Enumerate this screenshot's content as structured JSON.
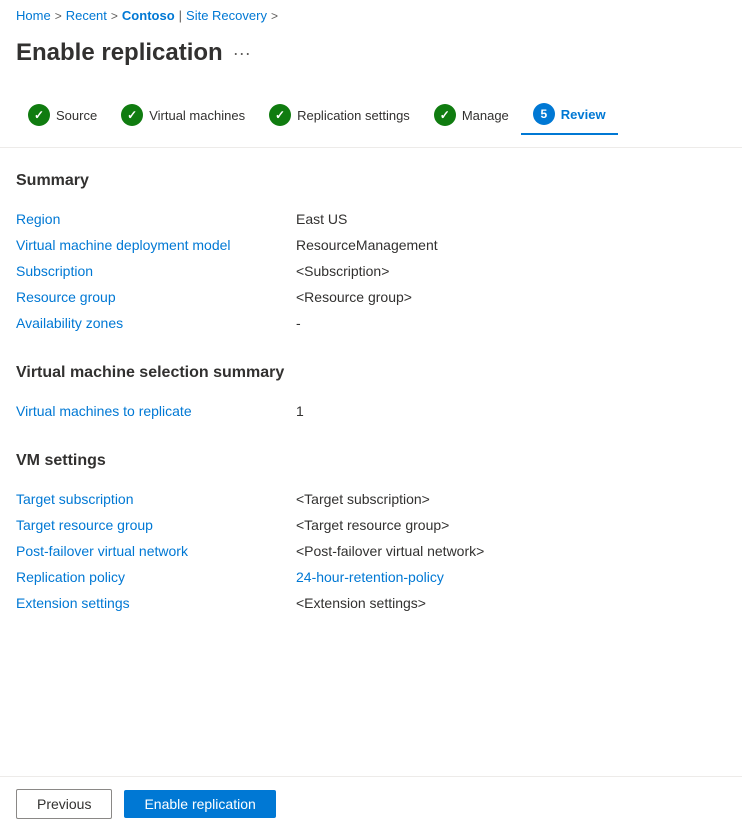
{
  "breadcrumb": {
    "home": "Home",
    "recent": "Recent",
    "contoso": "Contoso",
    "separator": ">",
    "siteRecovery": "Site Recovery"
  },
  "pageHeader": {
    "title": "Enable replication",
    "moreIcon": "···"
  },
  "steps": [
    {
      "id": "source",
      "label": "Source",
      "type": "check",
      "active": false
    },
    {
      "id": "virtual-machines",
      "label": "Virtual machines",
      "type": "check",
      "active": false
    },
    {
      "id": "replication-settings",
      "label": "Replication settings",
      "type": "check",
      "active": false
    },
    {
      "id": "manage",
      "label": "Manage",
      "type": "check",
      "active": false
    },
    {
      "id": "review",
      "label": "Review",
      "type": "number",
      "number": "5",
      "active": true
    }
  ],
  "summary": {
    "sectionTitle": "Summary",
    "rows": [
      {
        "label": "Region",
        "value": "East US",
        "isLink": false
      },
      {
        "label": "Virtual machine deployment model",
        "value": "ResourceManagement",
        "isLink": false
      },
      {
        "label": "Subscription",
        "value": "<Subscription>",
        "isLink": false
      },
      {
        "label": "Resource group",
        "value": "<Resource group>",
        "isLink": false
      },
      {
        "label": "Availability zones",
        "value": "-",
        "isLink": false
      }
    ]
  },
  "vmSelectionSummary": {
    "sectionTitle": "Virtual machine selection summary",
    "rows": [
      {
        "label": "Virtual machines to replicate",
        "value": "1",
        "isLink": false
      }
    ]
  },
  "vmSettings": {
    "sectionTitle": "VM settings",
    "rows": [
      {
        "label": "Target subscription",
        "value": "<Target subscription>",
        "isLink": false
      },
      {
        "label": "Target resource group",
        "value": "<Target resource group>",
        "isLink": false
      },
      {
        "label": "Post-failover virtual network",
        "value": "<Post-failover virtual network>",
        "isLink": false
      },
      {
        "label": "Replication policy",
        "value": "24-hour-retention-policy",
        "isLink": true
      },
      {
        "label": "Extension settings",
        "value": "<Extension settings>",
        "isLink": false
      }
    ]
  },
  "footer": {
    "previousLabel": "Previous",
    "enableLabel": "Enable replication"
  }
}
